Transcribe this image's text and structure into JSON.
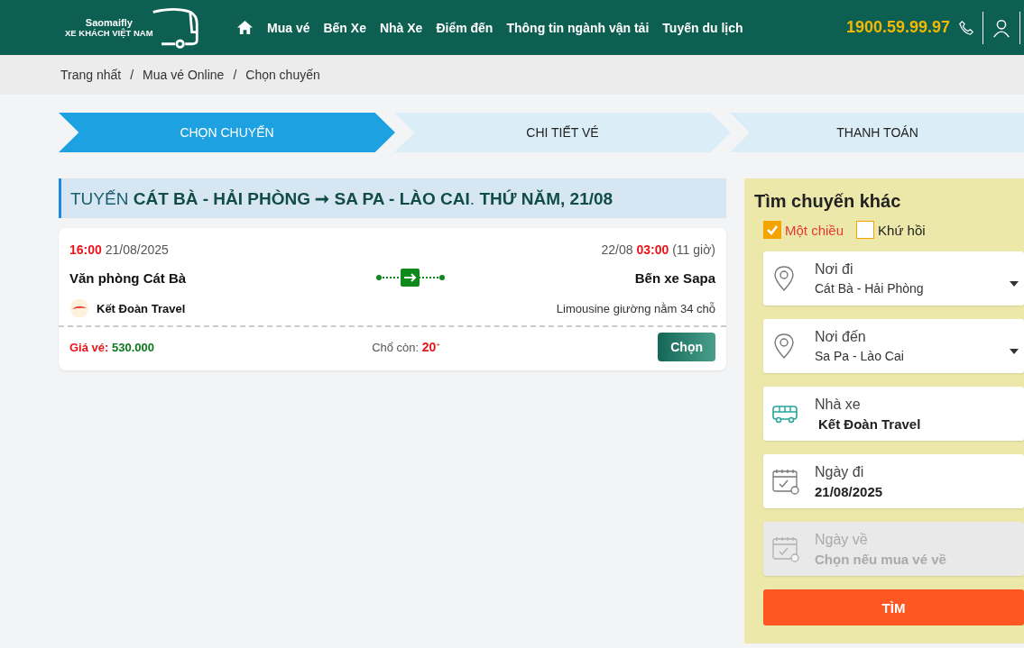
{
  "header": {
    "logo": {
      "brand": "Saomaifly",
      "tagline": "XE KHÁCH VIỆT NAM"
    },
    "nav": [
      {
        "kind": "home"
      },
      {
        "label": "Mua vé"
      },
      {
        "label": "Bến Xe"
      },
      {
        "label": "Nhà Xe"
      },
      {
        "label": "Điểm đến"
      },
      {
        "label": "Thông tin ngành vận tải"
      },
      {
        "label": "Tuyến du lịch"
      }
    ],
    "hotline": "1900.59.99.97"
  },
  "breadcrumb": {
    "items": [
      "Trang nhất",
      "Mua vé Online",
      "Chọn chuyến"
    ],
    "separator": "/"
  },
  "steps": [
    {
      "label": "CHỌN CHUYẾN",
      "selected": true
    },
    {
      "label": "CHI TIẾT VÉ",
      "selected": false
    },
    {
      "label": "THANH TOÁN",
      "selected": false
    }
  ],
  "route_title": "TUYẾN **CÁT BÀ - HẢI PHÒNG ➞ SA PA - LÀO CAI**. **THỨ NĂM, 21/08**",
  "trips": [
    {
      "depart_time": "16:00",
      "depart_date": "21/08/2025",
      "arrive_date": "22/08",
      "arrive_time": "03:00",
      "duration": "(11 giờ)",
      "from": "Văn phòng Cát Bà",
      "to": "Bến xe Sapa",
      "operator": "Kết Đoàn Travel",
      "vehicle": "Limousine giường nằm 34 chỗ",
      "price_label": "Giá vé:",
      "price": "530.000",
      "seats_label": "Chổ còn:",
      "seats": "20",
      "seats_more": "+",
      "button": "Chọn"
    }
  ],
  "search": {
    "title": "Tìm chuyến khác",
    "trip_types": [
      {
        "label": "Một chiều",
        "checked": true
      },
      {
        "label": "Khứ hồi",
        "checked": false
      }
    ],
    "fields": [
      {
        "kind": "select",
        "label": "Nơi đi",
        "value": "Cát Bà - Hải Phòng",
        "disabled": false
      },
      {
        "kind": "select",
        "label": "Nơi đến",
        "value": "Sa Pa - Lào Cai",
        "disabled": false
      },
      {
        "kind": "text",
        "label": "Nhà xe",
        "value": "Kết Đoàn Travel",
        "disabled": false
      },
      {
        "kind": "date",
        "label": "Ngày đi",
        "value": "21/08/2025",
        "disabled": false
      },
      {
        "kind": "date",
        "label": "Ngày về",
        "placeholder": "Chọn nếu mua vé về",
        "disabled": true
      }
    ],
    "button": "TÌM"
  }
}
